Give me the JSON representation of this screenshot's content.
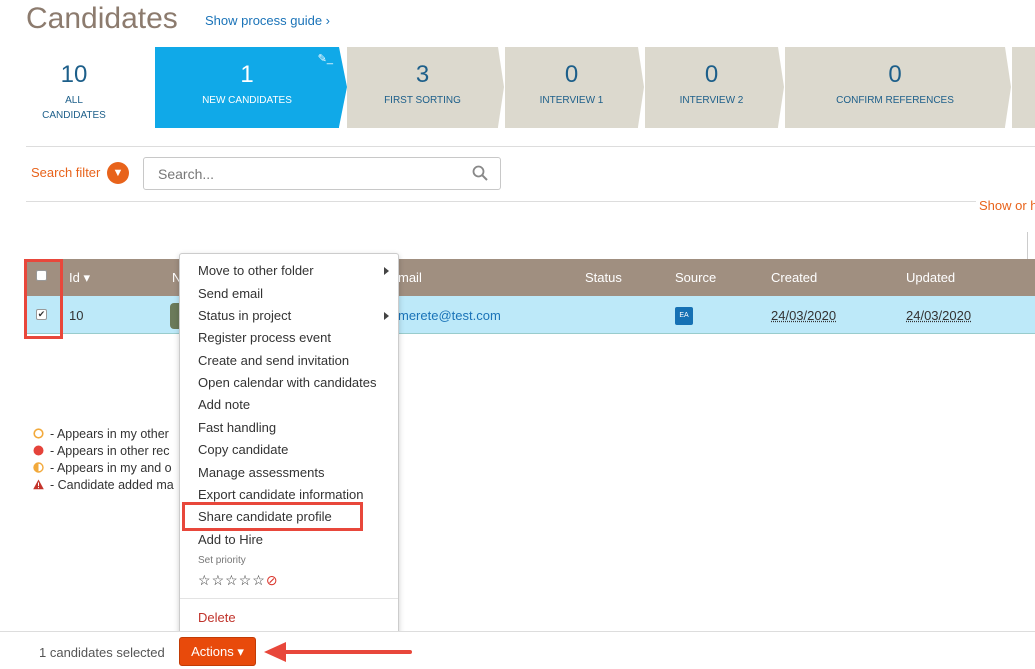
{
  "header": {
    "title": "Candidates",
    "process_guide": "Show process guide ›"
  },
  "pipeline": {
    "stages": [
      {
        "count": "10",
        "label": "ALL\nCANDIDATES"
      },
      {
        "count": "1",
        "label": "NEW CANDIDATES"
      },
      {
        "count": "3",
        "label": "FIRST SORTING"
      },
      {
        "count": "0",
        "label": "INTERVIEW 1"
      },
      {
        "count": "0",
        "label": "INTERVIEW 2"
      },
      {
        "count": "0",
        "label": "CONFIRM REFERENCES"
      }
    ]
  },
  "filter": {
    "label": "Search filter",
    "placeholder": "Search...",
    "show_hide": "Show or h"
  },
  "table": {
    "columns": [
      "Id",
      "N",
      "mail",
      "Status",
      "Source",
      "Created",
      "Updated"
    ],
    "row": {
      "id": "10",
      "email": "merete@test.com",
      "status": "",
      "source": "EA",
      "created": "24/03/2020",
      "updated": "24/03/2020"
    }
  },
  "legend": [
    "- Appears in my other",
    "- Appears in other rec",
    "- Appears in my and o",
    "- Candidate added ma"
  ],
  "menu": {
    "items": [
      "Move to other folder",
      "Send email",
      "Status in project",
      "Register process event",
      "Create and send invitation",
      "Open calendar with candidates",
      "Add note",
      "Fast handling",
      "Copy candidate",
      "Manage assessments",
      "Export candidate information",
      "Share candidate profile",
      "Add to Hire"
    ],
    "priority_label": "Set priority",
    "delete": "Delete"
  },
  "footer": {
    "selected": "1 candidates selected",
    "actions": "Actions ▾"
  },
  "colors": {
    "accent": "#e8631b",
    "active_stage": "#10a9e8",
    "table_header": "#a08f80",
    "selected_row": "#bde9f9",
    "highlight": "#e8473b"
  }
}
